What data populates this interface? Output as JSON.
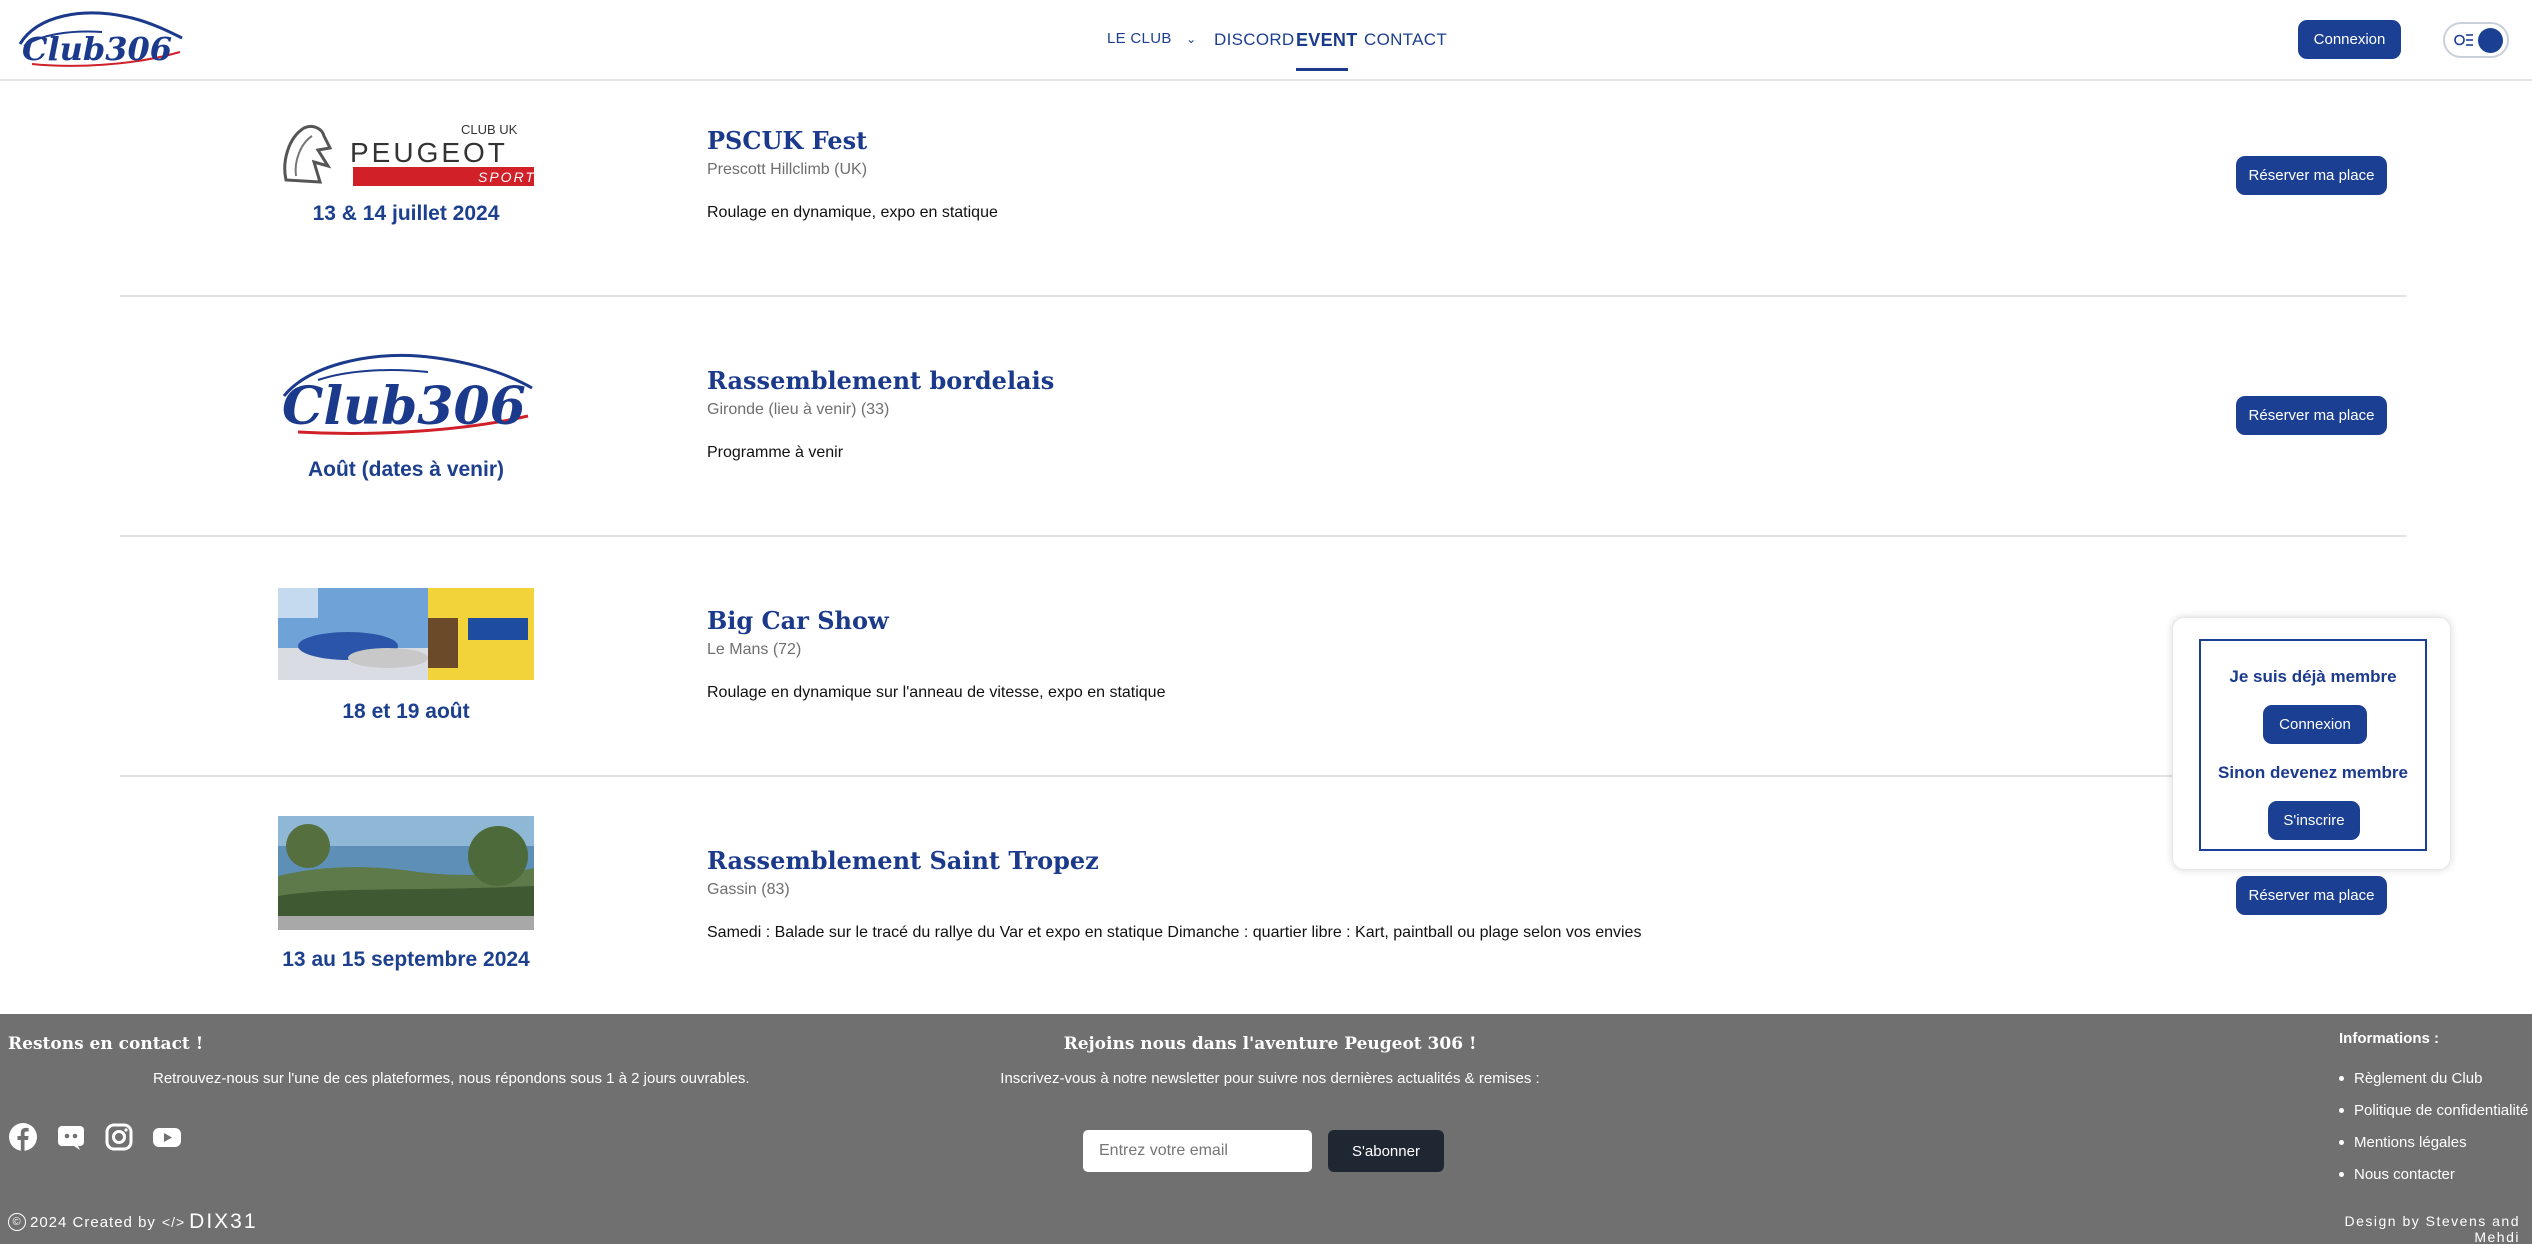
{
  "header": {
    "logo_text": "Club306",
    "nav": [
      {
        "label": "LE CLUB"
      },
      {
        "label": "DISCORD"
      },
      {
        "label": "EVENT"
      },
      {
        "label": "CONTACT"
      }
    ],
    "login_label": "Connexion"
  },
  "events": [
    {
      "title": "PSCUK Fest",
      "location": "Prescott Hillclimb (UK)",
      "description": "Roulage en dynamique, expo en statique",
      "date": "13 & 14 juillet 2024",
      "logo_top": "CLUB UK",
      "logo_main": "PEUGEOT",
      "logo_sub": "SPORT",
      "button": "Réserver ma place"
    },
    {
      "title": "Rassemblement bordelais",
      "location": "Gironde (lieu à venir) (33)",
      "description": "Programme à venir",
      "date": "Août (dates à venir)",
      "logo_text": "Club306",
      "button": "Réserver ma place"
    },
    {
      "title": "Big Car Show",
      "location": "Le Mans (72)",
      "description": "Roulage en dynamique sur l'anneau de vitesse, expo en statique",
      "date": "18 et 19 août",
      "button": ""
    },
    {
      "title": "Rassemblement Saint Tropez",
      "location": "Gassin (83)",
      "description": "Samedi : Balade sur le tracé du rallye du Var et expo en statique Dimanche : quartier libre : Kart, paintball ou plage selon vos envies",
      "date": "13 au 15 septembre 2024",
      "button": "Réserver ma place"
    }
  ],
  "popup": {
    "member_text": "Je suis déjà membre",
    "login_label": "Connexion",
    "join_text": "Sinon devenez membre",
    "signup_label": "S'inscrire"
  },
  "footer": {
    "contact_title": "Restons en contact !",
    "contact_text": "Retrouvez-nous sur l'une de ces plateformes, nous répondons sous 1 à 2 jours ouvrables.",
    "join_title": "Rejoins nous dans l'aventure Peugeot 306 !",
    "newsletter_text": "Inscrivez-vous à notre newsletter pour suivre nos dernières actualités & remises :",
    "email_placeholder": "Entrez votre email",
    "subscribe_label": "S'abonner",
    "info_title": "Informations :",
    "info_links": [
      "Règlement du Club",
      "Politique de confidentialité",
      "Mentions légales",
      "Nous contacter"
    ],
    "copyright": "2024 Created by",
    "agency": "DIX31",
    "design_credit": "Design by Stevens and Mehdi",
    "socials": [
      "facebook-icon",
      "discord-icon",
      "instagram-icon",
      "youtube-icon"
    ]
  },
  "colors": {
    "primary": "#1b3f93",
    "footer_bg": "#707070",
    "title": "#1b3a8c"
  }
}
